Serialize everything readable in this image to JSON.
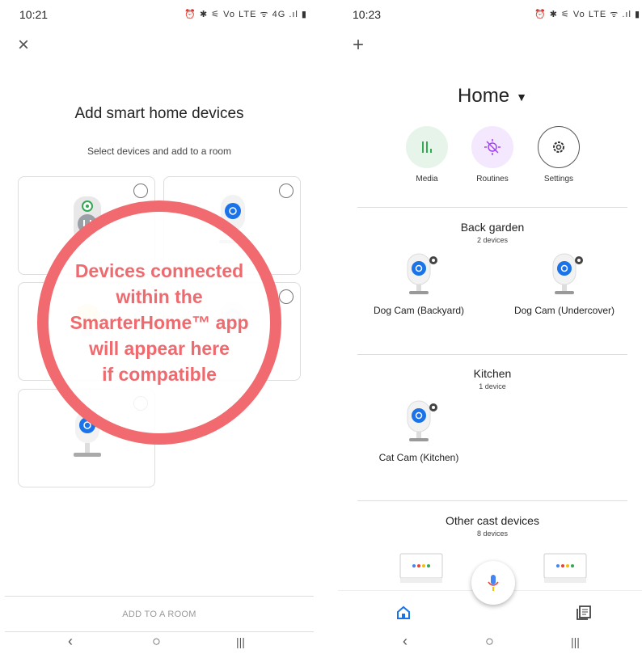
{
  "left": {
    "status": {
      "time": "10:21",
      "icons": "⏰ ✱ ⚟ Vo LTE ᯤ 4G .ıl ▮"
    },
    "close_label": "×",
    "title": "Add smart home devices",
    "subtitle": "Select devices and add to a room",
    "overlay_lines": [
      "Devices connected",
      "within the",
      "SmarterHome™ app",
      "will appear here",
      "if compatible"
    ],
    "add_to_room": "ADD TO A ROOM"
  },
  "right": {
    "status": {
      "time": "10:23",
      "icons": "⏰ ✱ ⚟ Vo LTE ᯤ .ıl ▮"
    },
    "plus_label": "+",
    "home_title": "Home",
    "actions": [
      {
        "label": "Media",
        "color": "#e6f4ea"
      },
      {
        "label": "Routines",
        "color": "#f3e8fd"
      },
      {
        "label": "Settings",
        "color": "#ffffff"
      }
    ],
    "rooms": [
      {
        "name": "Back garden",
        "count": "2 devices",
        "devices": [
          "Dog Cam (Backyard)",
          "Dog Cam (Undercover)"
        ]
      },
      {
        "name": "Kitchen",
        "count": "1 device",
        "devices": [
          "Cat Cam (Kitchen)"
        ]
      },
      {
        "name": "Other cast devices",
        "count": "8 devices",
        "devices": []
      }
    ]
  },
  "navbar": {
    "back": "‹",
    "home": "○",
    "recents": "|||"
  },
  "colors": {
    "accent": "#1a73e8",
    "overlay": "#f06a6f"
  }
}
